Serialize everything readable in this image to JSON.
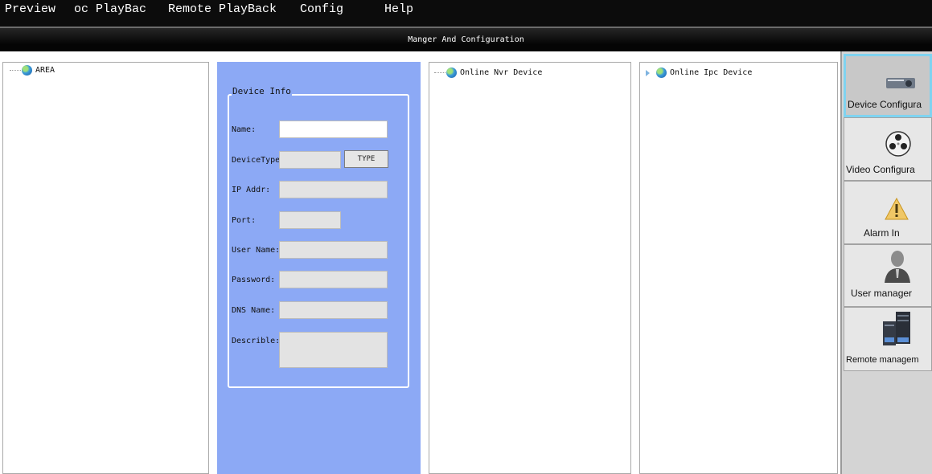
{
  "menu": {
    "preview": "Preview",
    "local_playback": "oc PlayBac",
    "remote_playback": "Remote PlayBack",
    "config": "Config",
    "help": "Help"
  },
  "title_bar": "Manger And Configuration",
  "area_tree": {
    "root": "AREA"
  },
  "device_info": {
    "group_title": "Device Info",
    "name_label": "Name:",
    "device_type_label": "DeviceType:",
    "type_button": "TYPE",
    "ip_label": "IP Addr:",
    "port_label": "Port:",
    "user_label": "User Name:",
    "password_label": "Password:",
    "dns_label": "DNS Name:",
    "describe_label": "Describle:"
  },
  "nvr_tree": {
    "root": "Online Nvr Device"
  },
  "ipc_tree": {
    "root": "Online Ipc Device"
  },
  "right_nav": {
    "device_config": "Device Configura",
    "video_config": "Video Configura",
    "alarm_in": "Alarm In",
    "user_manager": "User manager",
    "remote_management": "Remote managem"
  }
}
